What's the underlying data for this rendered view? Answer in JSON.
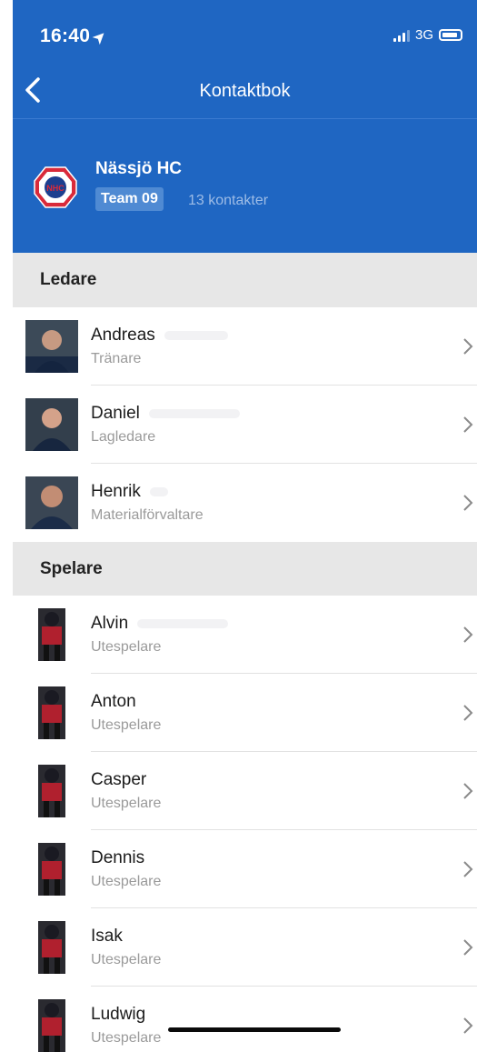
{
  "status": {
    "time": "16:40",
    "network": "3G"
  },
  "nav": {
    "title": "Kontaktbok"
  },
  "team": {
    "club_name": "Nässjö HC",
    "team_name": "Team 09",
    "contact_count": "13 kontakter",
    "logo_text": "NHC"
  },
  "sections": {
    "leaders": "Ledare",
    "players": "Spelare"
  },
  "leaders": [
    {
      "name": "Andreas",
      "role": "Tränare"
    },
    {
      "name": "Daniel",
      "role": "Lagledare"
    },
    {
      "name": "Henrik",
      "role": "Materialförvaltare"
    }
  ],
  "players": [
    {
      "name": "Alvin",
      "role": "Utespelare"
    },
    {
      "name": "Anton",
      "role": "Utespelare"
    },
    {
      "name": "Casper",
      "role": "Utespelare"
    },
    {
      "name": "Dennis",
      "role": "Utespelare"
    },
    {
      "name": "Isak",
      "role": "Utespelare"
    },
    {
      "name": "Ludwig",
      "role": "Utespelare"
    }
  ],
  "colors": {
    "header": "#1f66c2",
    "badge": "#4f8ad3",
    "section_bg": "#e7e7e7"
  }
}
